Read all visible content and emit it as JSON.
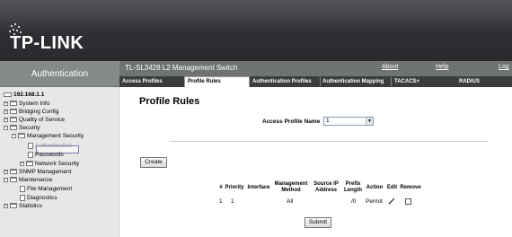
{
  "brand": {
    "logo_text": "TP-LINK"
  },
  "header": {
    "section_title": "Authentication",
    "device_name": "TL-SL3428 L2 Management Switch",
    "links": {
      "about": "About",
      "help": "Help",
      "logout": "Log"
    }
  },
  "tabs": [
    {
      "label": "Access Profiles",
      "active": false
    },
    {
      "label": "Profile Rules",
      "active": true
    },
    {
      "label": "Authentication Profiles",
      "active": false
    },
    {
      "label": "Authentication Mapping",
      "active": false
    },
    {
      "label": "TACACS+",
      "active": false
    },
    {
      "label": "RADIUS",
      "active": false
    }
  ],
  "sidebar": {
    "root": "192.168.1.1",
    "items": [
      {
        "label": "System Info",
        "expand": "+",
        "icon": "folder"
      },
      {
        "label": "Bridging Config",
        "expand": "+",
        "icon": "folder"
      },
      {
        "label": "Quality of Service",
        "expand": "+",
        "icon": "folder"
      },
      {
        "label": "Security",
        "expand": "-",
        "icon": "folder"
      },
      {
        "label": "Management Security",
        "expand": "-",
        "icon": "folder"
      },
      {
        "label": "Authentication",
        "icon": "doc",
        "selected": true
      },
      {
        "label": "Passwords",
        "icon": "doc"
      },
      {
        "label": "Network Security",
        "expand": "+",
        "icon": "folder"
      },
      {
        "label": "SNMP Management",
        "expand": "+",
        "icon": "folder"
      },
      {
        "label": "Maintenance",
        "expand": "-",
        "icon": "folder"
      },
      {
        "label": "File Management",
        "icon": "doc"
      },
      {
        "label": "Diagnostics",
        "icon": "doc"
      },
      {
        "label": "Statistics",
        "expand": "+",
        "icon": "folder"
      }
    ]
  },
  "main": {
    "title": "Profile Rules",
    "access_profile_label": "Access Profile Name",
    "access_profile_value": "1",
    "create_label": "Create",
    "submit_label": "Submit",
    "table": {
      "headers": [
        "#",
        "Priority",
        "Interface",
        "Management Method",
        "Source IP Address",
        "Prefix Length",
        "Action",
        "Edit",
        "Remove"
      ],
      "rows": [
        {
          "num": "1",
          "priority": "1",
          "interface": "",
          "method": "All",
          "source_ip": "",
          "prefix": "/0",
          "action": "Permit"
        }
      ]
    }
  },
  "colors": {
    "banner": "#2f2f33",
    "sidebar": "#e7e7e7",
    "tabbar": "#3b3d3c",
    "topbar": "#6f7371"
  }
}
